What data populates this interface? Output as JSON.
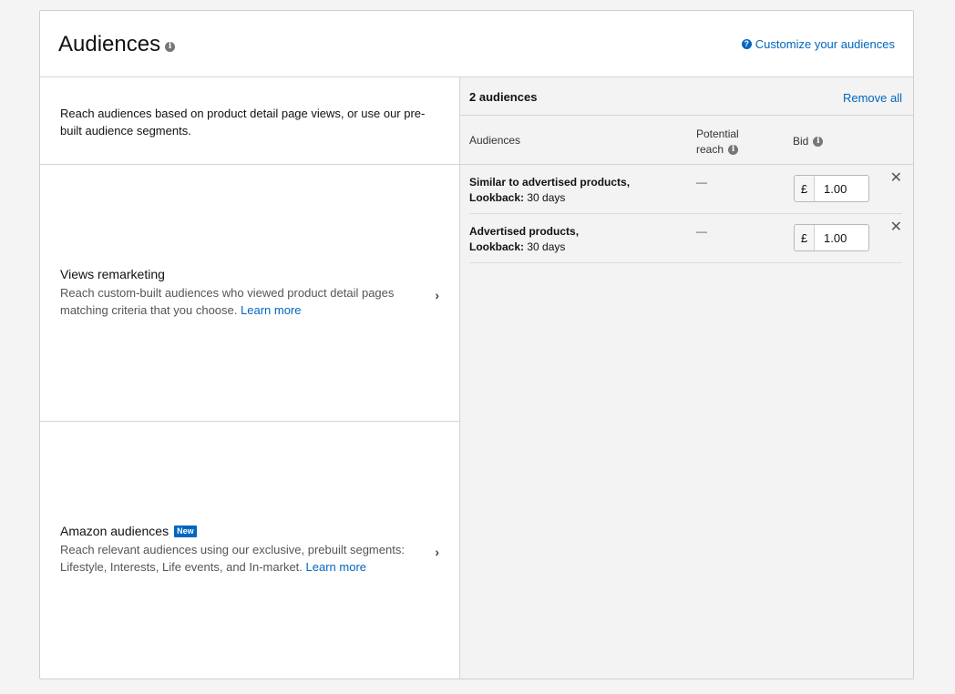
{
  "header": {
    "title": "Audiences",
    "info_glyph": "i",
    "customize_link": "Customize your audiences",
    "help_glyph": "?"
  },
  "left": {
    "intro": "Reach audiences based on product detail page views, or use our pre-built audience segments.",
    "options": [
      {
        "title": "Views remarketing",
        "badge": "",
        "desc": "Reach custom-built audiences who viewed product detail pages matching criteria that you choose.",
        "learn_more": "Learn more"
      },
      {
        "title": "Amazon audiences",
        "badge": "New",
        "desc": "Reach relevant audiences using our exclusive, prebuilt segments: Lifestyle, Interests, Life events, and In-market.",
        "learn_more": "Learn more"
      }
    ],
    "chevron": "›"
  },
  "right": {
    "count": "2 audiences",
    "remove_all": "Remove all",
    "headers": {
      "audiences": "Audiences",
      "reach_line1": "Potential",
      "reach_line2": "reach",
      "bid": "Bid"
    },
    "rows": [
      {
        "name": "Similar to advertised products,",
        "lookback_label": "Lookback:",
        "lookback_value": "30 days",
        "reach": "—",
        "currency": "£",
        "bid": "1.00",
        "remove": "✕"
      },
      {
        "name": "Advertised products,",
        "lookback_label": "Lookback:",
        "lookback_value": "30 days",
        "reach": "—",
        "currency": "£",
        "bid": "1.00",
        "remove": "✕"
      }
    ]
  },
  "colors": {
    "link": "#0066c0",
    "badge": "#0066c0",
    "panel_bg": "#f3f3f3"
  }
}
